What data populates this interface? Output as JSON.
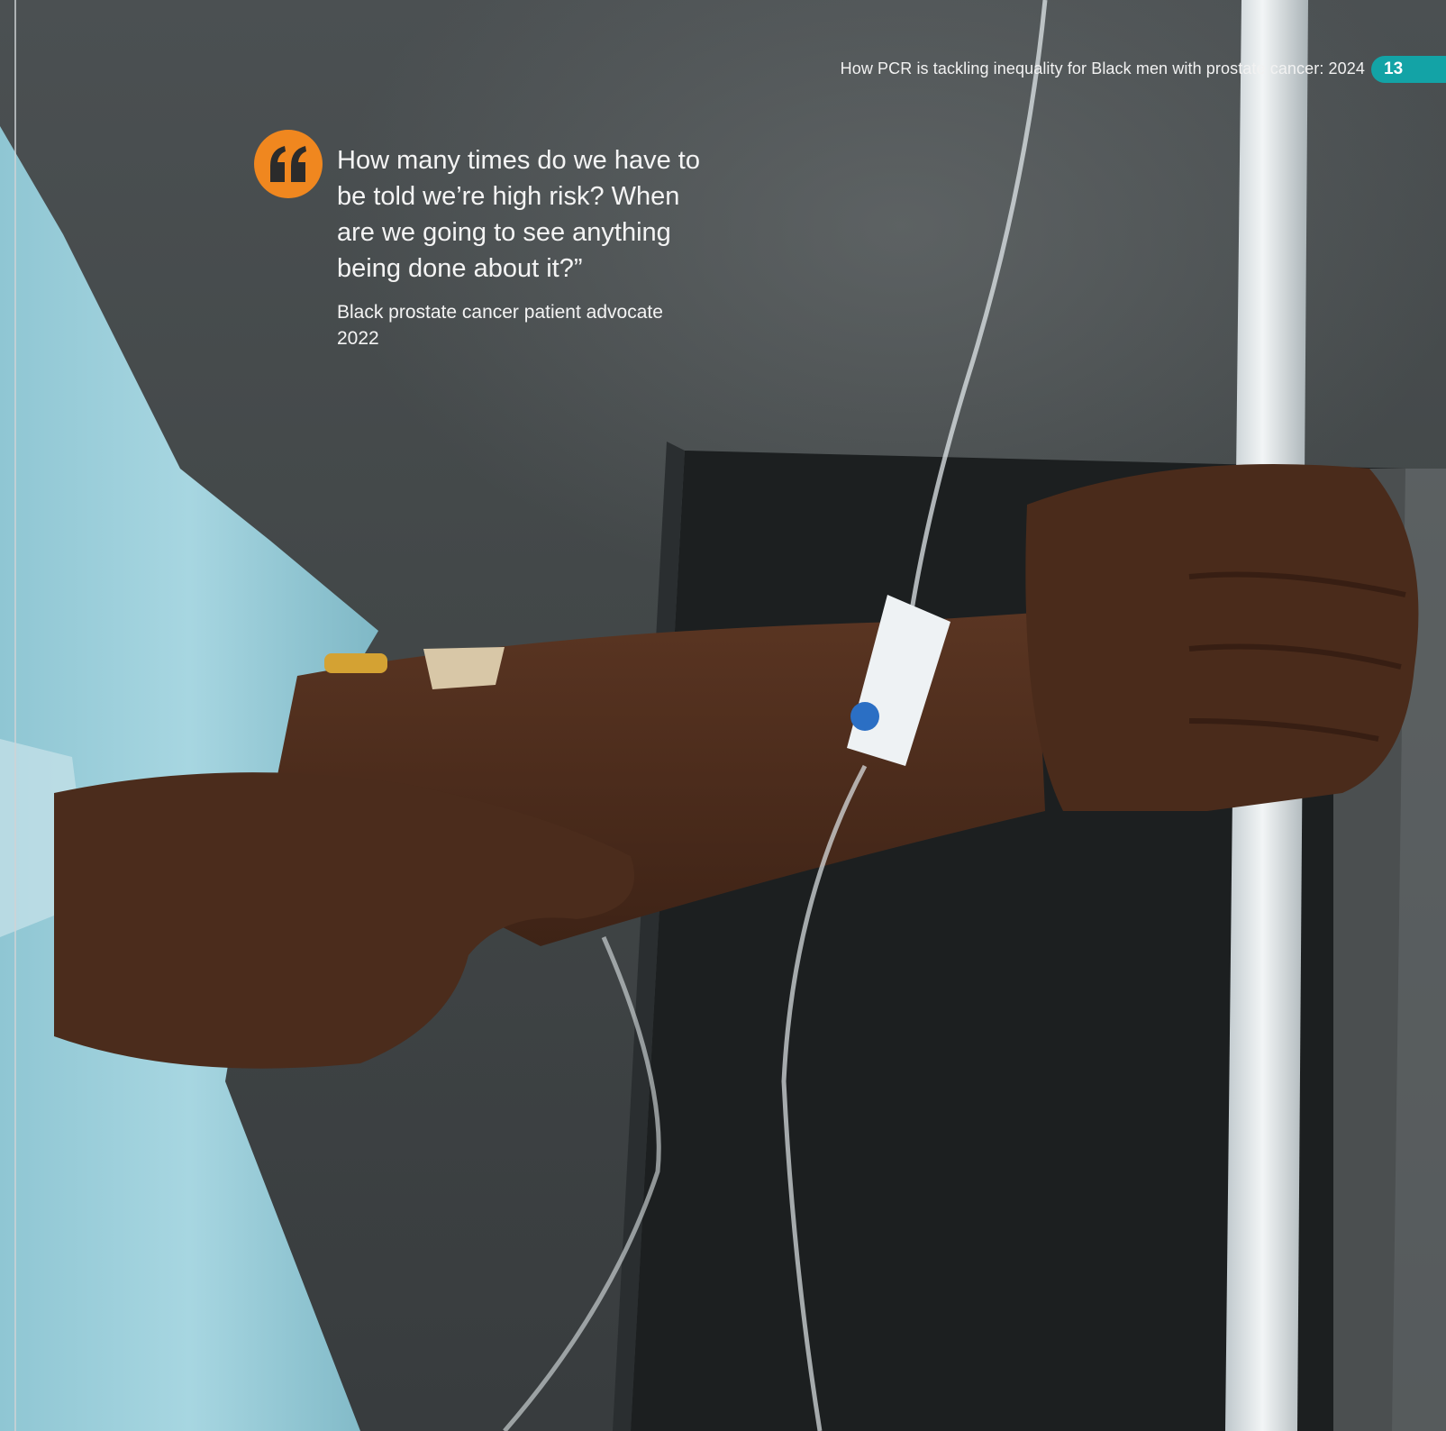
{
  "header": {
    "title": "How PCR is tackling inequality for Black men with prostate cancer: 2024",
    "page_number": "13",
    "accent_color": "#13a3a6"
  },
  "quote": {
    "icon": "quote-mark-icon",
    "icon_color": "#f0871f",
    "text": "How many times do we have to be told we’re high risk? When are we going to see anything being done about it?”",
    "source_line1": "Black prostate cancer patient advocate",
    "source_line2": "2022"
  }
}
